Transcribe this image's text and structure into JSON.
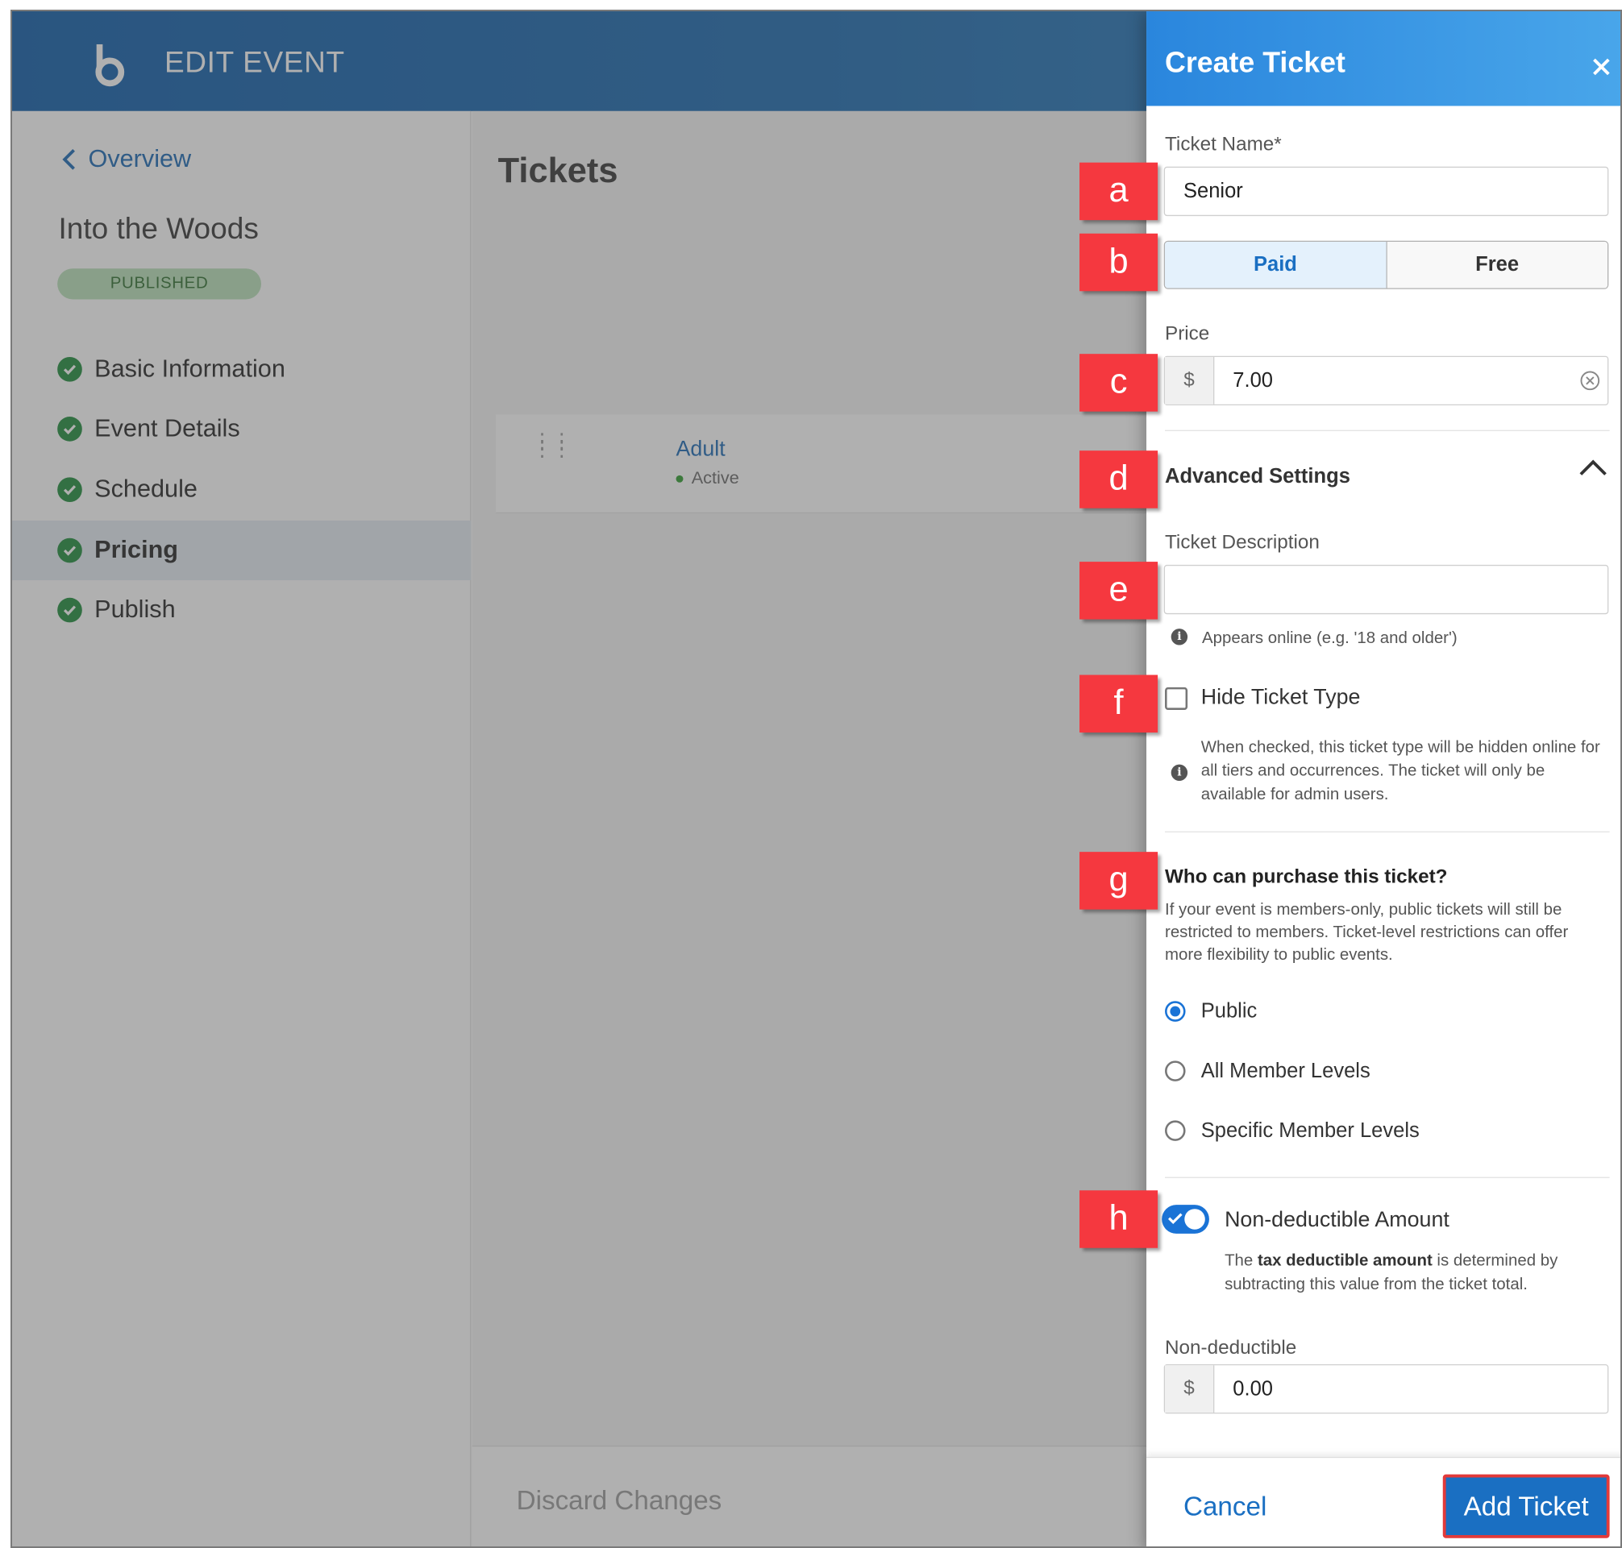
{
  "app": {
    "title": "EDIT EVENT"
  },
  "sidebar": {
    "back_label": "Overview",
    "event_name": "Into the Woods",
    "status_badge": "PUBLISHED",
    "items": [
      {
        "label": "Basic Information",
        "active": false
      },
      {
        "label": "Event Details",
        "active": false
      },
      {
        "label": "Schedule",
        "active": false
      },
      {
        "label": "Pricing",
        "active": true
      },
      {
        "label": "Publish",
        "active": false
      }
    ]
  },
  "main": {
    "title": "Tickets",
    "tickets": [
      {
        "name": "Adult",
        "status": "Active"
      }
    ],
    "discard_label": "Discard Changes"
  },
  "drawer": {
    "title": "Create Ticket",
    "close_icon": "close-icon",
    "ticket_name_label": "Ticket Name*",
    "ticket_name_value": "Senior",
    "type_options": [
      "Paid",
      "Free"
    ],
    "type_selected": "Paid",
    "price_label": "Price",
    "currency_symbol": "$",
    "price_value": "7.00",
    "advanced_title": "Advanced Settings",
    "description_label": "Ticket Description",
    "description_value": "",
    "description_hint": "Appears online (e.g. '18 and older')",
    "hide_label": "Hide Ticket Type",
    "hide_checked": false,
    "hide_desc": "When checked, this ticket type will be hidden online for all tiers and occurrences. The ticket will only be available for admin users.",
    "who_title": "Who can purchase this ticket?",
    "who_desc": "If your event is members-only, public tickets will still be restricted to members. Ticket-level restrictions can offer more flexibility to public events.",
    "audience_options": [
      "Public",
      "All Member Levels",
      "Specific Member Levels"
    ],
    "audience_selected": "Public",
    "nondeductible_toggle_label": "Non-deductible Amount",
    "nondeductible_toggle_on": true,
    "nondeductible_desc_pre": "The ",
    "nondeductible_desc_bold": "tax deductible amount",
    "nondeductible_desc_post": " is determined by subtracting this value from the ticket total.",
    "nondeductible_label": "Non-deductible",
    "nondeductible_value": "0.00",
    "cancel_label": "Cancel",
    "add_label": "Add Ticket"
  },
  "callouts": [
    "a",
    "b",
    "c",
    "d",
    "e",
    "f",
    "g",
    "h"
  ],
  "colors": {
    "header_blue": "#1767ae",
    "accent_blue": "#1a6fc2",
    "callout_red": "#f5383f",
    "success_green": "#1d8a3a"
  }
}
